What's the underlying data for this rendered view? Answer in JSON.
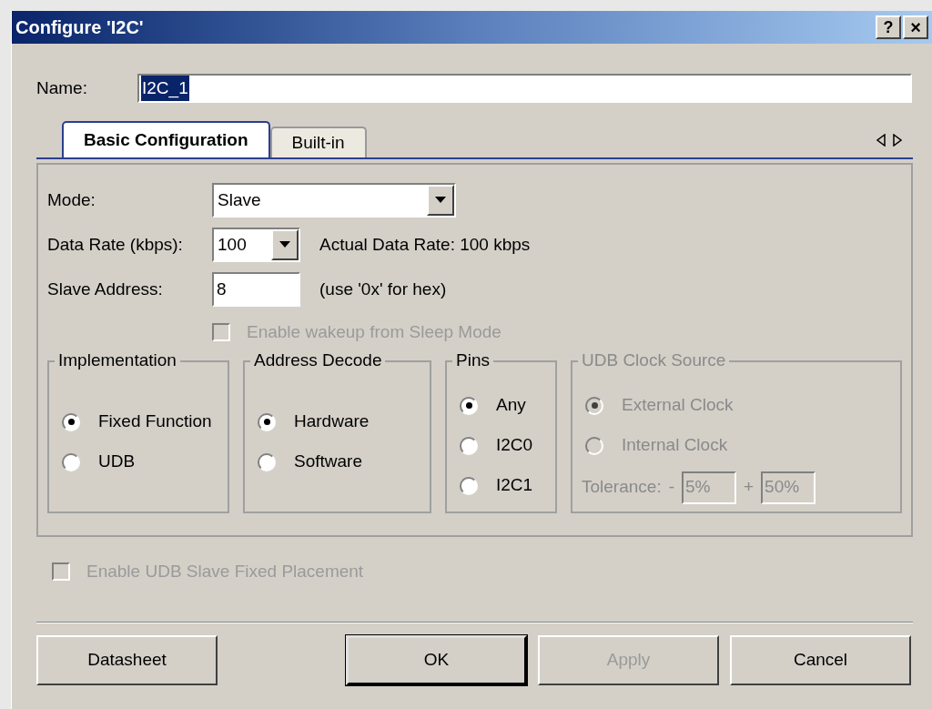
{
  "window": {
    "title": "Configure 'I2C'",
    "help": "?",
    "close": "×"
  },
  "name": {
    "label": "Name:",
    "value": "I2C_1"
  },
  "tabs": [
    {
      "label": "Basic Configuration",
      "selected": true
    },
    {
      "label": "Built-in",
      "selected": false
    }
  ],
  "mode": {
    "label": "Mode:",
    "value": "Slave"
  },
  "data_rate": {
    "label": "Data Rate (kbps):",
    "value": "100",
    "note": "Actual Data Rate: 100 kbps"
  },
  "slave_address": {
    "label": "Slave Address:",
    "value": "8",
    "note": "(use '0x' for hex)"
  },
  "wakeup": {
    "label": "Enable wakeup from Sleep Mode",
    "checked": false,
    "disabled": true
  },
  "groups": [
    {
      "title": "Implementation",
      "disabled": false,
      "options": [
        {
          "label": "Fixed Function",
          "selected": true
        },
        {
          "label": "UDB",
          "selected": false
        }
      ]
    },
    {
      "title": "Address Decode",
      "disabled": false,
      "options": [
        {
          "label": "Hardware",
          "selected": true
        },
        {
          "label": "Software",
          "selected": false
        }
      ]
    },
    {
      "title": "Pins",
      "disabled": false,
      "options": [
        {
          "label": "Any",
          "selected": true
        },
        {
          "label": "I2C0",
          "selected": false
        },
        {
          "label": "I2C1",
          "selected": false
        }
      ]
    },
    {
      "title": "UDB Clock Source",
      "disabled": true,
      "options": [
        {
          "label": "External Clock",
          "selected": true
        },
        {
          "label": "Internal Clock",
          "selected": false
        }
      ],
      "tolerance": {
        "label": "Tolerance:",
        "minus": "-",
        "min": "5%",
        "plus": "+",
        "max": "50%"
      }
    }
  ],
  "fixed_placement": {
    "label": "Enable UDB Slave Fixed Placement",
    "checked": false,
    "disabled": true
  },
  "buttons": [
    {
      "label": "Datasheet",
      "disabled": false,
      "default": false
    },
    {
      "label": "OK",
      "disabled": false,
      "default": true
    },
    {
      "label": "Apply",
      "disabled": true,
      "default": false
    },
    {
      "label": "Cancel",
      "disabled": false,
      "default": false
    }
  ]
}
